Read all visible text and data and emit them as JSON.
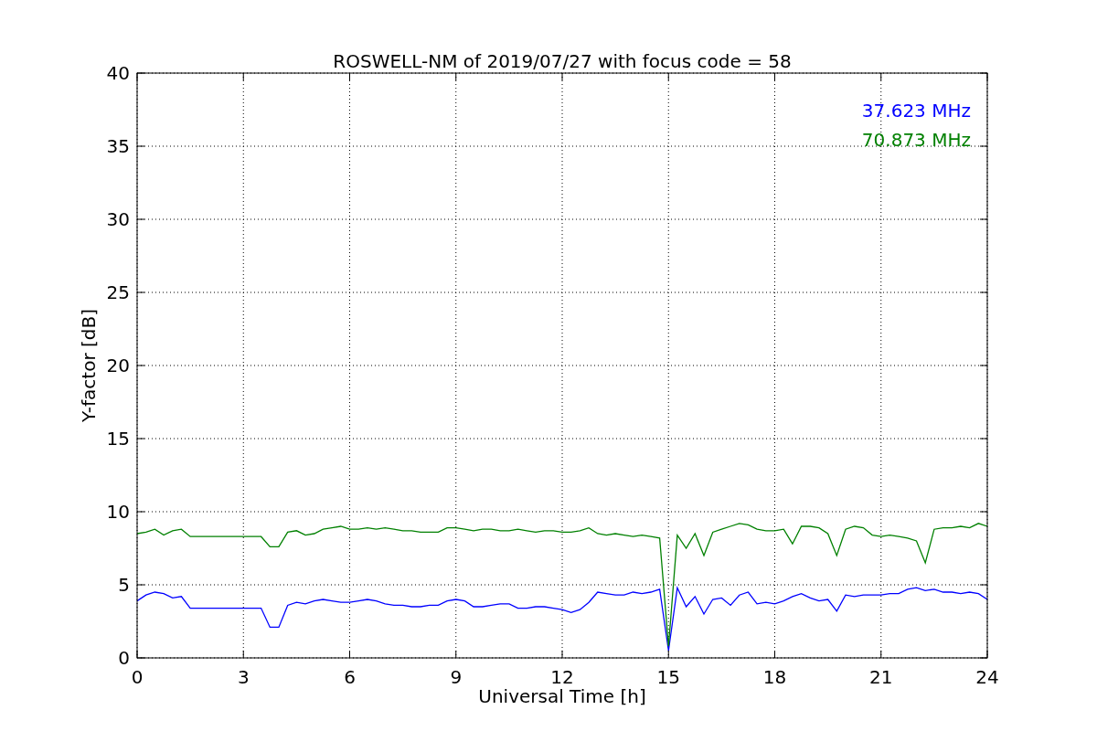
{
  "chart_data": {
    "type": "line",
    "title": "ROSWELL-NM of 2019/07/27 with focus code = 58",
    "xlabel": "Universal Time [h]",
    "ylabel": "Y-factor [dB]",
    "xlim": [
      0,
      24
    ],
    "ylim": [
      0,
      40
    ],
    "xticks": [
      0,
      3,
      6,
      9,
      12,
      15,
      18,
      21,
      24
    ],
    "yticks": [
      0,
      5,
      10,
      15,
      20,
      25,
      30,
      35,
      40
    ],
    "grid": true,
    "x": [
      0,
      0.25,
      0.5,
      0.75,
      1,
      1.25,
      1.5,
      1.75,
      2,
      2.25,
      2.5,
      2.75,
      3,
      3.25,
      3.5,
      3.75,
      4,
      4.25,
      4.5,
      4.75,
      5,
      5.25,
      5.5,
      5.75,
      6,
      6.25,
      6.5,
      6.75,
      7,
      7.25,
      7.5,
      7.75,
      8,
      8.25,
      8.5,
      8.75,
      9,
      9.25,
      9.5,
      9.75,
      10,
      10.25,
      10.5,
      10.75,
      11,
      11.25,
      11.5,
      11.75,
      12,
      12.25,
      12.5,
      12.75,
      13,
      13.25,
      13.5,
      13.75,
      14,
      14.25,
      14.5,
      14.75,
      15,
      15.25,
      15.5,
      15.75,
      16,
      16.25,
      16.5,
      16.75,
      17,
      17.25,
      17.5,
      17.75,
      18,
      18.25,
      18.5,
      18.75,
      19,
      19.25,
      19.5,
      19.75,
      20,
      20.25,
      20.5,
      20.75,
      21,
      21.25,
      21.5,
      21.75,
      22,
      22.25,
      22.5,
      22.75,
      23,
      23.25,
      23.5,
      23.75,
      24
    ],
    "series": [
      {
        "name": "37.623 MHz",
        "color": "#0000ff",
        "values": [
          3.9,
          4.3,
          4.5,
          4.4,
          4.1,
          4.2,
          3.4,
          3.4,
          3.4,
          3.4,
          3.4,
          3.4,
          3.4,
          3.4,
          3.4,
          2.1,
          2.1,
          3.6,
          3.8,
          3.7,
          3.9,
          4.0,
          3.9,
          3.8,
          3.8,
          3.9,
          4.0,
          3.9,
          3.7,
          3.6,
          3.6,
          3.5,
          3.5,
          3.6,
          3.6,
          3.9,
          4.0,
          3.9,
          3.5,
          3.5,
          3.6,
          3.7,
          3.7,
          3.4,
          3.4,
          3.5,
          3.5,
          3.4,
          3.3,
          3.1,
          3.3,
          3.8,
          4.5,
          4.4,
          4.3,
          4.3,
          4.5,
          4.4,
          4.5,
          4.7,
          0.5,
          4.8,
          3.5,
          4.2,
          3.0,
          4.0,
          4.1,
          3.6,
          4.3,
          4.5,
          3.7,
          3.8,
          3.7,
          3.9,
          4.2,
          4.4,
          4.1,
          3.9,
          4.0,
          3.2,
          4.3,
          4.2,
          4.3,
          4.3,
          4.3,
          4.4,
          4.4,
          4.7,
          4.8,
          4.6,
          4.7,
          4.5,
          4.5,
          4.4,
          4.5,
          4.4,
          4.0
        ]
      },
      {
        "name": "70.873 MHz",
        "color": "#008000",
        "values": [
          8.5,
          8.6,
          8.8,
          8.4,
          8.7,
          8.8,
          8.3,
          8.3,
          8.3,
          8.3,
          8.3,
          8.3,
          8.3,
          8.3,
          8.3,
          7.6,
          7.6,
          8.6,
          8.7,
          8.4,
          8.5,
          8.8,
          8.9,
          9.0,
          8.8,
          8.8,
          8.9,
          8.8,
          8.9,
          8.8,
          8.7,
          8.7,
          8.6,
          8.6,
          8.6,
          8.9,
          8.9,
          8.8,
          8.7,
          8.8,
          8.8,
          8.7,
          8.7,
          8.8,
          8.7,
          8.6,
          8.7,
          8.7,
          8.6,
          8.6,
          8.7,
          8.9,
          8.5,
          8.4,
          8.5,
          8.4,
          8.3,
          8.4,
          8.3,
          8.2,
          0.8,
          8.4,
          7.5,
          8.5,
          7.0,
          8.6,
          8.8,
          9.0,
          9.2,
          9.1,
          8.8,
          8.7,
          8.7,
          8.8,
          7.8,
          9.0,
          9.0,
          8.9,
          8.5,
          7.0,
          8.8,
          9.0,
          8.9,
          8.4,
          8.3,
          8.4,
          8.3,
          8.2,
          8.0,
          6.5,
          8.8,
          8.9,
          8.9,
          9.0,
          8.9,
          9.2,
          9.0
        ]
      }
    ]
  }
}
